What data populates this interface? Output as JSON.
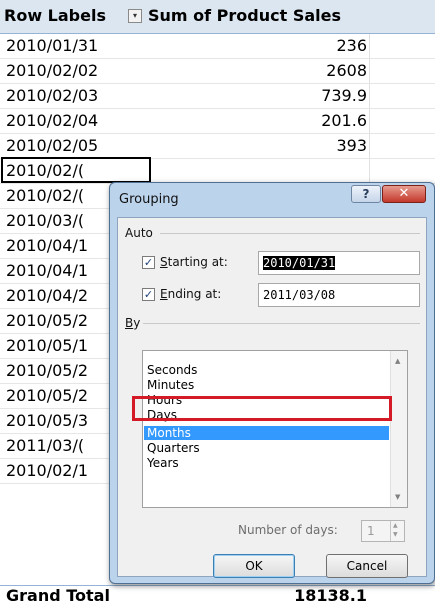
{
  "pivot": {
    "header": {
      "row_labels": "Row Labels",
      "filter_glyph": "▾",
      "sum_label": "Sum of Product Sales"
    },
    "rows": [
      {
        "label": "2010/01/31",
        "value": "236"
      },
      {
        "label": "2010/02/02",
        "value": "2608"
      },
      {
        "label": "2010/02/03",
        "value": "739.9"
      },
      {
        "label": "2010/02/04",
        "value": "201.6"
      },
      {
        "label": "2010/02/05",
        "value": "393"
      },
      {
        "label": "2010/02/(",
        "value": ""
      },
      {
        "label": "2010/02/(",
        "value": ""
      },
      {
        "label": "2010/03/(",
        "value": ""
      },
      {
        "label": "2010/04/1",
        "value": ""
      },
      {
        "label": "2010/04/1",
        "value": ""
      },
      {
        "label": "2010/04/2",
        "value": ""
      },
      {
        "label": "2010/05/2",
        "value": ""
      },
      {
        "label": "2010/05/1",
        "value": ""
      },
      {
        "label": "2010/05/2",
        "value": ""
      },
      {
        "label": "2010/05/2",
        "value": ""
      },
      {
        "label": "2010/05/3",
        "value": ""
      },
      {
        "label": "2011/03/(",
        "value": ""
      },
      {
        "label": "2010/02/1",
        "value": ""
      }
    ],
    "grand_total": {
      "label": "Grand Total",
      "value": "18138.1"
    }
  },
  "dialog": {
    "title": "Grouping",
    "help_glyph": "?",
    "close_glyph": "✕",
    "auto_label": "Auto",
    "starting_at": {
      "checkbox_glyph": "✓",
      "label_ul": "S",
      "label_rest": "tarting at:",
      "value": "2010/01/31"
    },
    "ending_at": {
      "checkbox_glyph": "✓",
      "label_ul": "E",
      "label_rest": "nding at:",
      "value": "2011/03/08"
    },
    "by_label_ul": "B",
    "by_label_rest": "y",
    "by_options": [
      "Seconds",
      "Minutes",
      "Hours",
      "Days",
      "Months",
      "Quarters",
      "Years"
    ],
    "selected_option": "Months",
    "scroll_up_glyph": "▲",
    "scroll_down_glyph": "▼",
    "number_of_days_label": "Number of days:",
    "number_of_days_value": "1",
    "spin_up": "▲",
    "spin_down": "▼",
    "ok_label": "OK",
    "cancel_label": "Cancel"
  },
  "colors": {
    "header_bg": "#dce6f1",
    "dialog_frame": "#bcd3ec",
    "selection": "#3399ff",
    "highlight_box": "#d41a26",
    "close_button": "#c3392b"
  }
}
